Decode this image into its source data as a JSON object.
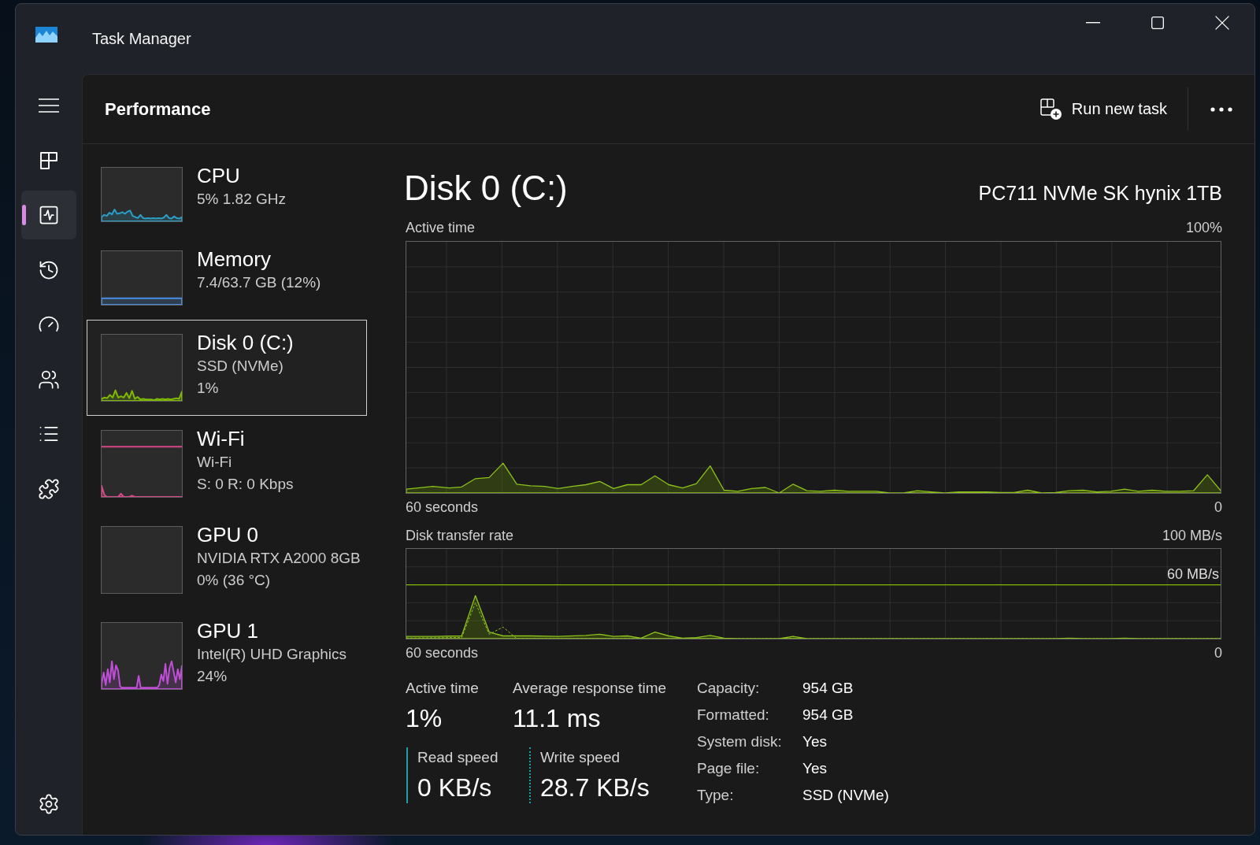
{
  "window": {
    "title": "Task Manager"
  },
  "nav": {
    "items": [
      {
        "kind": "processes",
        "selected": false
      },
      {
        "kind": "performance",
        "selected": true
      },
      {
        "kind": "history",
        "selected": false
      },
      {
        "kind": "startup",
        "selected": false
      },
      {
        "kind": "users",
        "selected": false
      },
      {
        "kind": "details",
        "selected": false
      },
      {
        "kind": "services",
        "selected": false
      }
    ],
    "footer": [
      {
        "kind": "settings",
        "selected": false
      }
    ]
  },
  "header": {
    "title": "Performance",
    "actions": [
      {
        "label": "Run new task"
      }
    ]
  },
  "devices": [
    {
      "name": "CPU",
      "lines": [
        "5% 1.82 GHz"
      ],
      "color": "#2aa0c8",
      "selected": false
    },
    {
      "name": "Memory",
      "lines": [
        "7.4/63.7 GB (12%)"
      ],
      "color": "#4a8fe6",
      "selected": false
    },
    {
      "name": "Disk 0 (C:)",
      "lines": [
        "SSD (NVMe)",
        "1%"
      ],
      "color": "#7fba00",
      "selected": true
    },
    {
      "name": "Wi-Fi",
      "lines": [
        "Wi-Fi",
        "S: 0 R: 0 Kbps"
      ],
      "color": "#d9468a",
      "selected": false
    },
    {
      "name": "GPU 0",
      "lines": [
        "NVIDIA RTX A2000 8GB",
        "0% (36 °C)"
      ],
      "selected": false
    },
    {
      "name": "GPU 1",
      "lines": [
        "Intel(R) UHD Graphics",
        "24%"
      ],
      "color": "#c04ed8",
      "selected": false
    }
  ],
  "detail": {
    "title": "Disk 0 (C:)",
    "model": "PC711 NVMe SK hynix 1TB",
    "graphs": [
      {
        "kind": "active",
        "label": "Active time",
        "max": "100%",
        "x_start": "60 seconds",
        "x_end": "0"
      },
      {
        "kind": "transfer",
        "label": "Disk transfer rate",
        "max": "100 MB/s",
        "ref_label": "60 MB/s",
        "x_start": "60 seconds",
        "x_end": "0"
      }
    ],
    "stats": [
      {
        "label": "Active time",
        "value": "1%"
      },
      {
        "label": "Average response time",
        "value": "11.1 ms"
      }
    ],
    "speeds": [
      {
        "kind": "read",
        "label": "Read speed",
        "value": "0 KB/s"
      },
      {
        "kind": "write",
        "label": "Write speed",
        "value": "28.7 KB/s"
      }
    ],
    "properties": [
      {
        "label": "Capacity:",
        "value": "954 GB"
      },
      {
        "label": "Formatted:",
        "value": "954 GB"
      },
      {
        "label": "System disk:",
        "value": "Yes"
      },
      {
        "label": "Page file:",
        "value": "Yes"
      },
      {
        "label": "Type:",
        "value": "SSD (NVMe)"
      }
    ]
  }
}
